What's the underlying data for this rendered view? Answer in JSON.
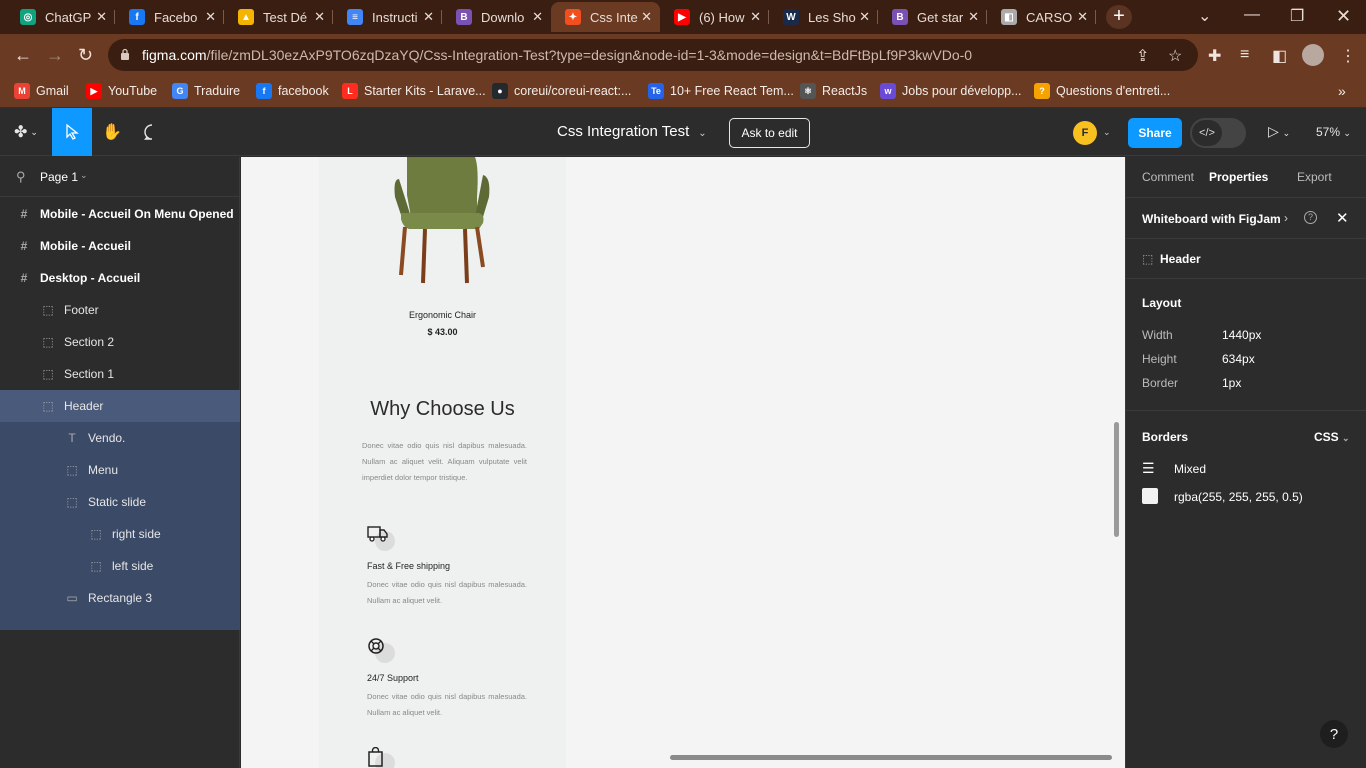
{
  "tabs": [
    {
      "title": "ChatGP",
      "icon": "chatgpt-icon",
      "color": "#10a37f",
      "glyph": "◎"
    },
    {
      "title": "Facebo",
      "icon": "facebook-icon",
      "color": "#1877f2",
      "glyph": "f"
    },
    {
      "title": "Test Dé",
      "icon": "google-drive-icon",
      "color": "#f4b400",
      "glyph": "▲"
    },
    {
      "title": "Instructi",
      "icon": "google-docs-icon",
      "color": "#4285f4",
      "glyph": "≡"
    },
    {
      "title": "Downlo",
      "icon": "bootstrap-icon",
      "color": "#7952b3",
      "glyph": "B"
    },
    {
      "title": "Css Inte",
      "icon": "figma-icon",
      "color": "#f24e1e",
      "glyph": "✦"
    },
    {
      "title": "(6) How",
      "icon": "youtube-icon",
      "color": "#ff0000",
      "glyph": "▶"
    },
    {
      "title": "Les Sho",
      "icon": "w-icon",
      "color": "#1b2a4a",
      "glyph": "W"
    },
    {
      "title": "Get star",
      "icon": "bootstrap-icon",
      "color": "#7952b3",
      "glyph": "B"
    },
    {
      "title": "CARSO",
      "icon": "site-icon",
      "color": "#aaaaaa",
      "glyph": "◧"
    }
  ],
  "url_host": "figma.com",
  "url_path": "/file/zmDL30ezAxP9TO6zqDzaYQ/Css-Integration-Test?type=design&node-id=1-3&mode=design&t=BdFtBpLf9P3kwVDo-0",
  "bookmarks": [
    {
      "label": "Gmail",
      "icon": "gmail-icon",
      "color": "#ea4335",
      "glyph": "M"
    },
    {
      "label": "YouTube",
      "icon": "youtube-icon",
      "color": "#ff0000",
      "glyph": "▶"
    },
    {
      "label": "Traduire",
      "icon": "translate-icon",
      "color": "#4285f4",
      "glyph": "G"
    },
    {
      "label": "facebook",
      "icon": "facebook-icon",
      "color": "#1877f2",
      "glyph": "f"
    },
    {
      "label": "Starter Kits - Larave...",
      "icon": "laravel-icon",
      "color": "#ff2d20",
      "glyph": "L"
    },
    {
      "label": "coreui/coreui-react:...",
      "icon": "github-icon",
      "color": "#24292e",
      "glyph": "●"
    },
    {
      "label": "10+ Free React Tem...",
      "icon": "te-icon",
      "color": "#2563eb",
      "glyph": "Te"
    },
    {
      "label": "ReactJs",
      "icon": "reactjs-icon",
      "color": "#555555",
      "glyph": "⚛"
    },
    {
      "label": "Jobs pour développ...",
      "icon": "wcd-icon",
      "color": "#6a4bd8",
      "glyph": "w"
    },
    {
      "label": "Questions d'entreti...",
      "icon": "questions-icon",
      "color": "#f4a300",
      "glyph": "?"
    }
  ],
  "toolbar": {
    "title": "Css Integration Test",
    "ask_edit": "Ask to edit",
    "avatar": "F",
    "share": "Share",
    "zoom": "57%"
  },
  "layers": {
    "page": "Page 1",
    "items": [
      {
        "label": "Mobile - Accueil On Menu Opened",
        "kind": "frame",
        "icon": "#",
        "indent": 0,
        "state": ""
      },
      {
        "label": "Mobile - Accueil",
        "kind": "frame",
        "icon": "#",
        "indent": 0,
        "state": ""
      },
      {
        "label": "Desktop - Accueil",
        "kind": "frame",
        "icon": "#",
        "indent": 0,
        "state": ""
      },
      {
        "label": "Footer",
        "kind": "group",
        "icon": "⬚",
        "indent": 1,
        "state": ""
      },
      {
        "label": "Section 2",
        "kind": "group",
        "icon": "⬚",
        "indent": 1,
        "state": ""
      },
      {
        "label": "Section 1",
        "kind": "group",
        "icon": "⬚",
        "indent": 1,
        "state": ""
      },
      {
        "label": "Header",
        "kind": "group",
        "icon": "⬚",
        "indent": 1,
        "state": "sel"
      },
      {
        "label": "Vendo.",
        "kind": "text",
        "icon": "T",
        "indent": 2,
        "state": "child"
      },
      {
        "label": "Menu",
        "kind": "group",
        "icon": "⬚",
        "indent": 2,
        "state": "child"
      },
      {
        "label": "Static slide",
        "kind": "group",
        "icon": "⬚",
        "indent": 2,
        "state": "child"
      },
      {
        "label": "right side",
        "kind": "group",
        "icon": "⬚",
        "indent": 3,
        "state": "child"
      },
      {
        "label": "left side",
        "kind": "group",
        "icon": "⬚",
        "indent": 3,
        "state": "child"
      },
      {
        "label": "Rectangle 3",
        "kind": "rect",
        "icon": "▭",
        "indent": 2,
        "state": "child"
      }
    ]
  },
  "canvas": {
    "product_name": "Ergonomic Chair",
    "product_price": "$ 43.00",
    "heading": "Why Choose Us",
    "intro": "Donec vitae odio quis nisl dapibus malesuada. Nullam ac aliquet velit. Aliquam vulputate velit imperdiet dolor tempor tristique.",
    "features": [
      {
        "title": "Fast & Free shipping",
        "text": "Donec vitae odio quis nisl dapibus malesuada. Nullam ac aliquet velit.",
        "icon": "truck-icon"
      },
      {
        "title": "24/7 Support",
        "text": "Donec vitae odio quis nisl dapibus malesuada. Nullam ac aliquet velit.",
        "icon": "support-lifebuoy-icon"
      },
      {
        "title": "",
        "text": "",
        "icon": "shopping-bag-icon"
      }
    ],
    "colors": {
      "chair_seat": "#6b7a3a",
      "chair_legs": "#8a4a22"
    }
  },
  "props": {
    "tabs": [
      "Comment",
      "Properties",
      "Export"
    ],
    "whiteboard": "Whiteboard with FigJam",
    "selected": "Header",
    "layout_title": "Layout",
    "width_label": "Width",
    "width_value": "1440px",
    "height_label": "Height",
    "height_value": "634px",
    "border_label": "Border",
    "border_value": "1px",
    "borders_title": "Borders",
    "css_label": "CSS",
    "mixed": "Mixed",
    "color_value": "rgba(255, 255, 255, 0.5)"
  },
  "help": "?"
}
